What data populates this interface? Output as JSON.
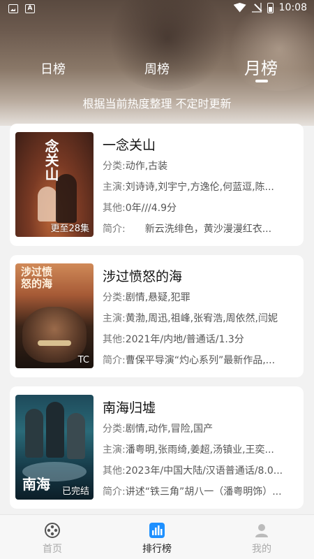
{
  "status_bar": {
    "time": "10:08"
  },
  "tabs": [
    {
      "label": "日榜"
    },
    {
      "label": "周榜"
    },
    {
      "label": "月榜"
    }
  ],
  "active_tab": "月榜",
  "subtitle": "根据当前热度整理 不定时更新",
  "items": [
    {
      "title": "一念关山",
      "poster_text": "念关山",
      "badge": "更至28集",
      "genre_label": "分类:",
      "genre": "动作,古装",
      "cast_label": "主演:",
      "cast": "刘诗诗,刘宇宁,方逸伦,何蓝逗,陈...",
      "other_label": "其他:",
      "other": "0年///4.9分",
      "intro_label": "简介:",
      "intro": "　　新云洗绯色，黄沙漫漫红衣..."
    },
    {
      "title": "涉过愤怒的海",
      "poster_text": "涉过愤怒的海",
      "badge": "TC",
      "genre_label": "分类:",
      "genre": "剧情,悬疑,犯罪",
      "cast_label": "主演:",
      "cast": "黄渤,周迅,祖峰,张宥浩,周依然,闫妮",
      "other_label": "其他:",
      "other": "2021年/内地/普通话/1.3分",
      "intro_label": "简介:",
      "intro": "曹保平导演“灼心系列”最新作品,..."
    },
    {
      "title": "南海归墟",
      "poster_text": "南海",
      "badge": "已完结",
      "genre_label": "分类:",
      "genre": "剧情,动作,冒险,国产",
      "cast_label": "主演:",
      "cast": "潘粤明,张雨绮,姜超,汤镇业,王奕...",
      "other_label": "其他:",
      "other": "2023年/中国大陆/汉语普通话/8.0...",
      "intro_label": "简介:",
      "intro": "讲述“铁三角”胡八一（潘粤明饰）..."
    }
  ],
  "bottom_nav": [
    {
      "label": "首页",
      "icon": "film-reel-icon"
    },
    {
      "label": "排行榜",
      "icon": "chart-icon"
    },
    {
      "label": "我的",
      "icon": "user-icon"
    }
  ],
  "colors": {
    "accent": "#1e90ff",
    "header_dark": "#5a4a40"
  }
}
